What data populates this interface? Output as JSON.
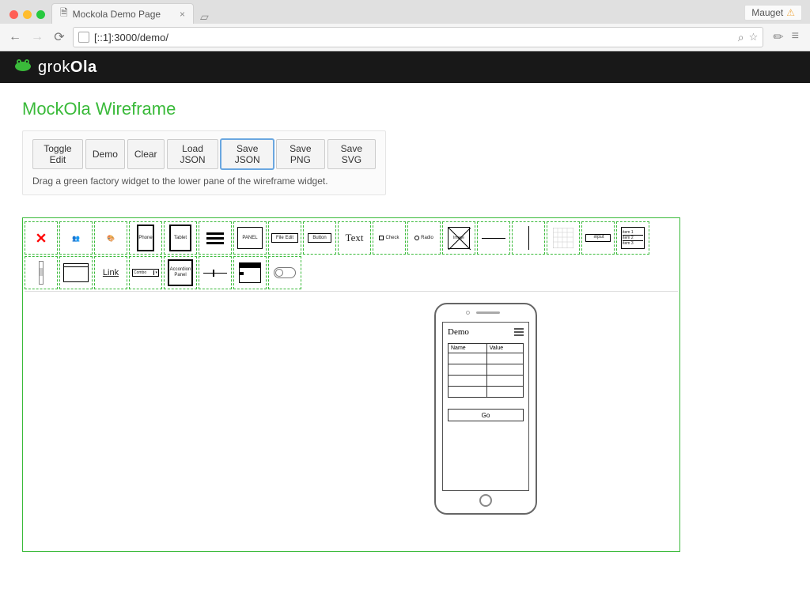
{
  "browser": {
    "tab_title": "Mockola Demo Page",
    "user": "Mauget",
    "url": "[::1]:3000/demo/"
  },
  "brand": {
    "name_pre": "grok",
    "name_bold": "Ola"
  },
  "page": {
    "title": "MockOla Wireframe",
    "hint": "Drag a green factory widget to the lower pane of the wireframe widget."
  },
  "toolbar": {
    "toggle_edit": "Toggle Edit",
    "demo": "Demo",
    "clear": "Clear",
    "load_json": "Load JSON",
    "save_json": "Save JSON",
    "save_png": "Save PNG",
    "save_svg": "Save SVG"
  },
  "palette": {
    "phone": "Phone",
    "tablet": "Tablet",
    "panel": "PANEL",
    "file": "File",
    "edit": "Edit",
    "button": "Button",
    "text": "Text",
    "check": "Check",
    "radio": "Radio",
    "image": "Image",
    "input": "input",
    "item1": "item 1",
    "item2": "item 2",
    "item3": "item 3",
    "link": "Link",
    "combo": "Combo",
    "accordion": "Accordion Panel"
  },
  "mockup": {
    "title": "Demo",
    "col_name": "Name",
    "col_value": "Value",
    "go": "Go"
  }
}
